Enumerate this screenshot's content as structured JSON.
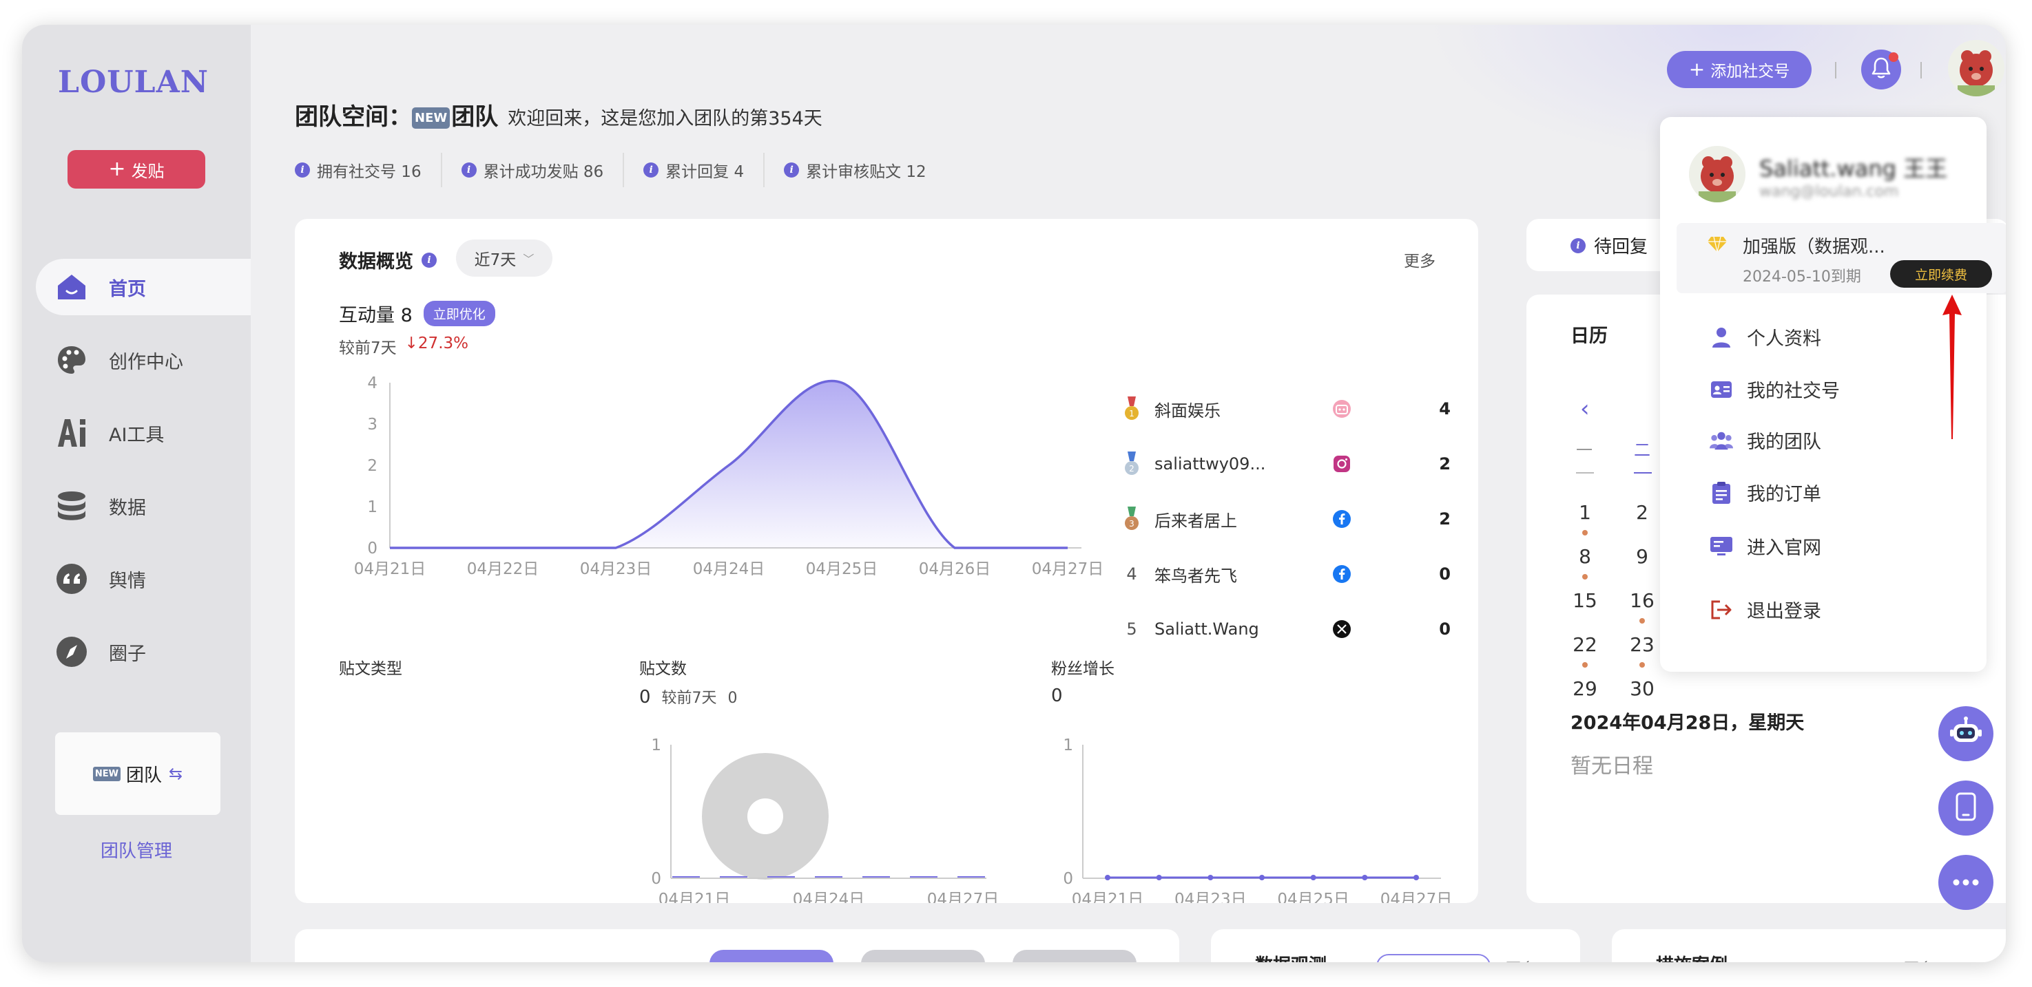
{
  "brand": {
    "logo": "LOULAN",
    "post_label": "发贴"
  },
  "sidebar": {
    "items": [
      {
        "label": "首页"
      },
      {
        "label": "创作中心"
      },
      {
        "label": "AI工具"
      },
      {
        "label": "数据"
      },
      {
        "label": "舆情"
      },
      {
        "label": "圈子"
      }
    ],
    "team_card": {
      "tag": "NEW",
      "label": "团队"
    },
    "team_manage": "团队管理"
  },
  "header": {
    "title": "团队空间：",
    "title_tag": "NEW",
    "team_name": "团队",
    "welcome": "欢迎回来，这是您加入团队的第354天",
    "add_social": "添加社交号",
    "stats": [
      {
        "label": "拥有社交号 16"
      },
      {
        "label": "累计成功发贴 86"
      },
      {
        "label": "累计回复 4"
      },
      {
        "label": "累计审核贴文 12"
      }
    ]
  },
  "overview": {
    "title": "数据概览",
    "range": "近7天",
    "more": "更多",
    "interaction_label": "互动量 8",
    "optimize_btn": "立即优化",
    "compare_label": "较前7天",
    "compare_value": "27.3%",
    "ranking": [
      {
        "rank": "1",
        "name": "斜面娱乐",
        "platform": "bilibili",
        "value": "4"
      },
      {
        "rank": "2",
        "name": "saliattwy09...",
        "platform": "instagram",
        "value": "2"
      },
      {
        "rank": "3",
        "name": "后来者居上",
        "platform": "facebook",
        "value": "2"
      },
      {
        "rank": "4",
        "name": "笨鸟者先飞",
        "platform": "facebook",
        "value": "0"
      },
      {
        "rank": "5",
        "name": "Saliatt.Wang",
        "platform": "x",
        "value": "0"
      }
    ],
    "post_type_label": "贴文类型",
    "post_count_label": "贴文数",
    "post_count_value": "0",
    "post_count_compare_label": "较前7天",
    "post_count_compare_value": "0",
    "fans_label": "粉丝增长",
    "fans_value": "0"
  },
  "pending": {
    "label": "待回复"
  },
  "calendar": {
    "title": "日历",
    "weekdays": [
      "一",
      "二"
    ],
    "days": [
      "1",
      "2",
      "8",
      "9",
      "15",
      "16",
      "22",
      "23",
      "29",
      "30"
    ],
    "selected_date": "2024年04月28日，星期天",
    "empty_text": "暂无日程"
  },
  "bottom": {
    "monitor_title": "数据观测",
    "monitor_more": "更多",
    "case_title": "措施案例",
    "case_more": "更多"
  },
  "dropdown": {
    "user_name": "Saliatt.wang 王王",
    "user_sub": "wang@loulan.com",
    "plan_name": "加强版（数据观...",
    "plan_expiry": "2024-05-10到期",
    "renew_label": "立即续费",
    "menu": [
      {
        "label": "个人资料"
      },
      {
        "label": "我的社交号"
      },
      {
        "label": "我的团队"
      },
      {
        "label": "我的订单"
      },
      {
        "label": "进入官网"
      },
      {
        "label": "退出登录"
      }
    ]
  },
  "colors": {
    "accent": "#7a72e2",
    "post_btn": "#d94760",
    "down": "#d03030"
  },
  "chart_data": [
    {
      "type": "area",
      "x": [
        "04月21日",
        "04月22日",
        "04月23日",
        "04月24日",
        "04月25日",
        "04月26日",
        "04月27日"
      ],
      "series": [
        {
          "values": [
            0,
            0,
            0,
            2,
            4,
            0,
            0
          ]
        }
      ],
      "ylim": [
        0,
        4
      ],
      "yticks": [
        "0",
        "1",
        "2",
        "3",
        "4"
      ]
    },
    {
      "type": "pie",
      "series": [
        {
          "values": [
            0
          ]
        }
      ]
    },
    {
      "type": "bar",
      "x": [
        "04月21日",
        "04月24日",
        "04月27日"
      ],
      "series": [
        {
          "values": [
            0,
            0,
            0,
            0,
            0,
            0,
            0
          ]
        }
      ],
      "ylim": [
        0,
        1
      ],
      "yticks": [
        "0",
        "1"
      ]
    },
    {
      "type": "line",
      "x": [
        "04月21日",
        "04月23日",
        "04月25日",
        "04月27日"
      ],
      "series": [
        {
          "values": [
            0,
            0,
            0,
            0,
            0,
            0,
            0
          ]
        }
      ],
      "ylim": [
        0,
        1
      ],
      "yticks": [
        "0",
        "1"
      ]
    }
  ]
}
